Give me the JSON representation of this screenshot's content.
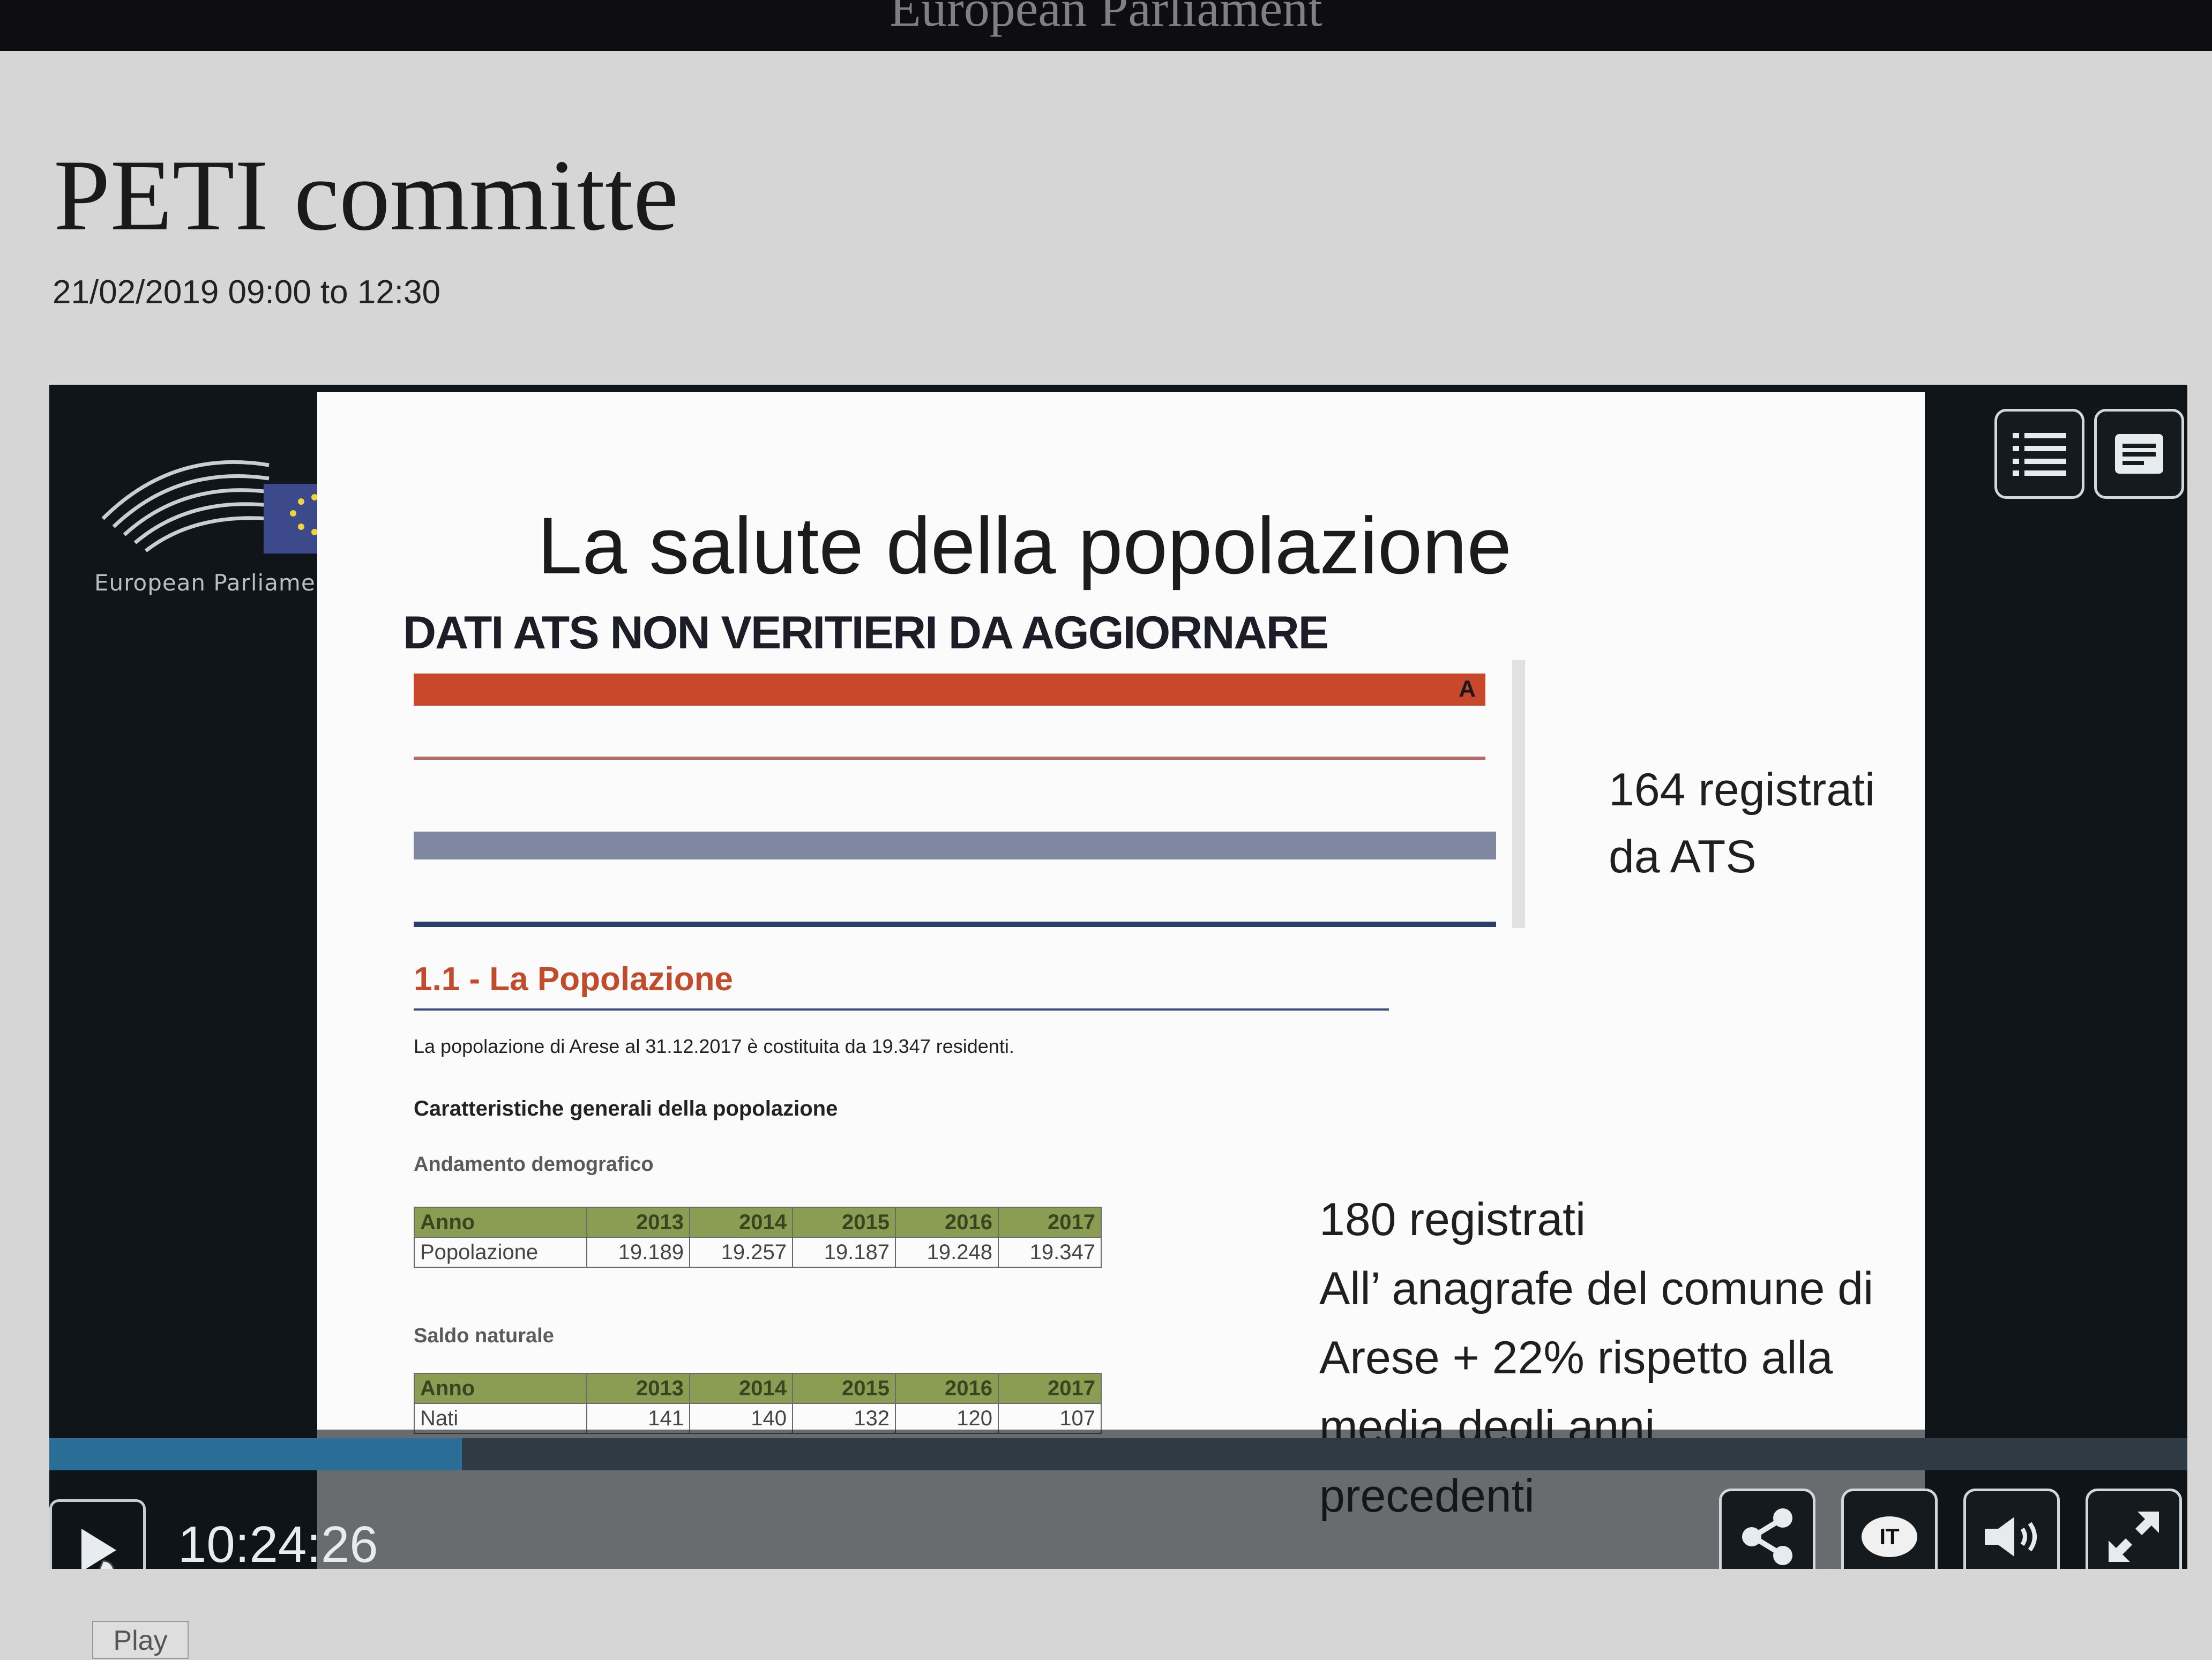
{
  "topbar": {
    "title": "European Parliament"
  },
  "page": {
    "title": "PETI committe",
    "date_range": "21/02/2019 09:00 to 12:30"
  },
  "player": {
    "logo_text": "European Parliament",
    "time": "10:24:26",
    "progress": 0.193,
    "play_tooltip": "Play",
    "language_badge": "IT",
    "top_controls": [
      "chapters-list-icon",
      "subtitles-icon"
    ],
    "bottom_controls": [
      "share-icon",
      "language-icon",
      "volume-icon",
      "fullscreen-icon"
    ]
  },
  "slide": {
    "title": "La salute della popolazione",
    "subtitle": "DATI ATS NON VERITIERI DA AGGIORNARE",
    "note_top": [
      "164 registrati",
      "da ATS"
    ],
    "note_bottom": [
      "180 registrati",
      "All’ anagrafe del comune di",
      "Arese + 22% rispetto alla",
      "media degli anni",
      "precedenti"
    ],
    "document": {
      "section_heading": "1.1 - La Popolazione",
      "paragraph": "La popolazione di Arese al 31.12.2017 è costituita da 19.347 residenti.",
      "general_heading": "Caratteristiche generali della popolazione",
      "andamento_label": "Andamento demografico",
      "saldo_label": "Saldo naturale",
      "table1": {
        "header": [
          "Anno",
          "2013",
          "2014",
          "2015",
          "2016",
          "2017"
        ],
        "rows": [
          [
            "Popolazione",
            "19.189",
            "19.257",
            "19.187",
            "19.248",
            "19.347"
          ]
        ]
      },
      "table2": {
        "header": [
          "Anno",
          "2013",
          "2014",
          "2015",
          "2016",
          "2017"
        ],
        "rows": [
          [
            "Nati",
            "141",
            "140",
            "132",
            "120",
            "107"
          ]
        ]
      }
    }
  },
  "colors": {
    "accent_orange": "#c9472a",
    "progress_blue": "#2a6e98",
    "table_header_green": "#8a9d52"
  }
}
